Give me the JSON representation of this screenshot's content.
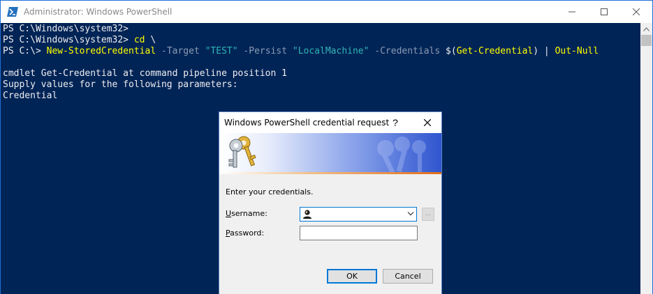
{
  "window": {
    "title": "Administrator: Windows PowerShell",
    "controls": {
      "minimize": "minimize",
      "maximize": "maximize",
      "close": "close"
    }
  },
  "console": {
    "lines": [
      {
        "segments": [
          {
            "text": "PS C:\\Windows\\system32> ",
            "color": "white"
          }
        ]
      },
      {
        "segments": [
          {
            "text": "PS C:\\Windows\\system32> ",
            "color": "white"
          },
          {
            "text": "cd ",
            "color": "yellow"
          },
          {
            "text": "\\",
            "color": "white"
          }
        ]
      },
      {
        "segments": [
          {
            "text": "PS C:\\> ",
            "color": "white"
          },
          {
            "text": "New-StoredCredential",
            "color": "yellow"
          },
          {
            "text": " -Target ",
            "color": "gray"
          },
          {
            "text": "\"TEST\"",
            "color": "cyan"
          },
          {
            "text": " -Persist ",
            "color": "gray"
          },
          {
            "text": "\"LocalMachine\"",
            "color": "cyan"
          },
          {
            "text": " -Credentials ",
            "color": "gray"
          },
          {
            "text": "$(",
            "color": "white"
          },
          {
            "text": "Get-Credential",
            "color": "yellow"
          },
          {
            "text": ") | ",
            "color": "white"
          },
          {
            "text": "Out-Null",
            "color": "yellow"
          }
        ]
      },
      {
        "segments": [
          {
            "text": "",
            "color": "white"
          }
        ]
      },
      {
        "segments": [
          {
            "text": "cmdlet Get-Credential at command pipeline position 1",
            "color": "white"
          }
        ]
      },
      {
        "segments": [
          {
            "text": "Supply values for the following parameters:",
            "color": "white"
          }
        ]
      },
      {
        "segments": [
          {
            "text": "Credential",
            "color": "white"
          }
        ]
      }
    ]
  },
  "dialog": {
    "title": "Windows PowerShell credential request",
    "help_label": "?",
    "prompt": "Enter your credentials.",
    "username_label": {
      "accel": "U",
      "rest": "sername:"
    },
    "username_value": "",
    "password_label": {
      "accel": "P",
      "rest": "assword:"
    },
    "password_value": "",
    "browse_label": "...",
    "ok_label": "OK",
    "cancel_label": "Cancel"
  },
  "colors": {
    "console_bg": "#012456",
    "console_text": "#eeedf0",
    "command": "#ffff00",
    "parameter": "#8b9bb4",
    "string": "#2fb5b5",
    "accent": "#0078d7"
  }
}
